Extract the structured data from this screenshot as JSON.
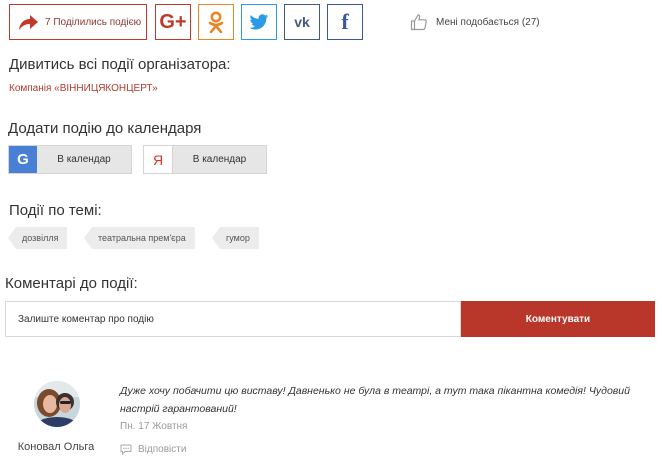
{
  "share": {
    "main_label": "7 Поділились подією",
    "buttons": [
      {
        "network": "Google+",
        "icon": "google-plus-icon",
        "glyph": "G+",
        "color": "#c0392b"
      },
      {
        "network": "Odnoklassniki",
        "icon": "odnoklassniki-icon",
        "color": "#e8862a"
      },
      {
        "network": "Twitter",
        "icon": "twitter-icon",
        "color": "#2b9be6"
      },
      {
        "network": "VK",
        "icon": "vk-icon",
        "glyph": "vk",
        "color": "#445b7c"
      },
      {
        "network": "Facebook",
        "icon": "facebook-icon",
        "glyph": "f",
        "color": "#3b5998"
      }
    ],
    "accent": "#c0392b"
  },
  "like": {
    "label": "Мені подобається (27)",
    "icon": "thumbs-up-icon"
  },
  "organizer": {
    "heading": "Дивитись всі події організатора:",
    "link": "Компанія «ВІННИЦЯКОНЦЕРТ»"
  },
  "calendar": {
    "heading": "Додати подію до календаря",
    "google": {
      "icon_glyph": "G",
      "label": "В календар"
    },
    "yandex": {
      "icon_glyph": "Я",
      "label": "В календар"
    }
  },
  "topics": {
    "heading": "Події по темі:",
    "tags": [
      "дозвілля",
      "театральна прем'єра",
      "гумор"
    ]
  },
  "comments": {
    "heading": "Коментарі до події:",
    "input_placeholder": "Залиште коментар про подію",
    "input_value": "",
    "submit_label": "Коментувати",
    "submit_color": "#b8362a",
    "items": [
      {
        "author": "Коновал Ольга",
        "text": "Дуже хочу побачити цю виставу! Давненько не була в театрі, а тут така пікантна комедія! Чудовий настрій гарантований!",
        "date": "Пн. 17 Жовтня",
        "reply_label": "Відповісти"
      }
    ]
  }
}
